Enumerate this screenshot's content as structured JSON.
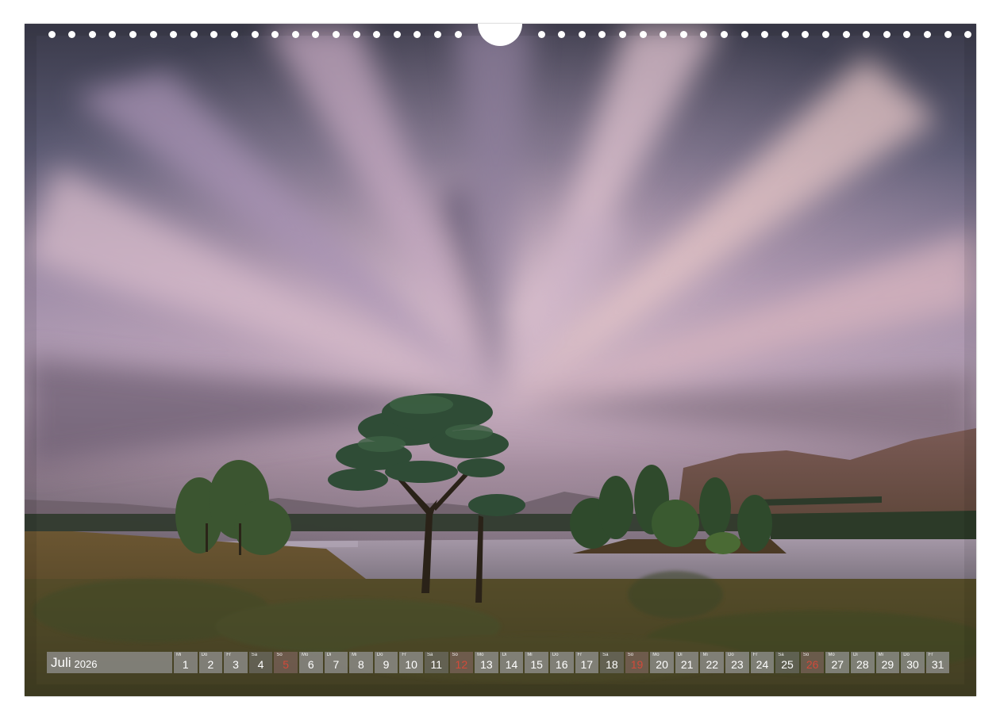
{
  "calendar": {
    "month": "Juli",
    "year": "2026",
    "days": [
      {
        "abbr": "Mi",
        "num": "1",
        "type": "weekday"
      },
      {
        "abbr": "Do",
        "num": "2",
        "type": "weekday"
      },
      {
        "abbr": "Fr",
        "num": "3",
        "type": "weekday"
      },
      {
        "abbr": "Sa",
        "num": "4",
        "type": "weekend"
      },
      {
        "abbr": "So",
        "num": "5",
        "type": "sunday"
      },
      {
        "abbr": "Mo",
        "num": "6",
        "type": "weekday"
      },
      {
        "abbr": "Di",
        "num": "7",
        "type": "weekday"
      },
      {
        "abbr": "Mi",
        "num": "8",
        "type": "weekday"
      },
      {
        "abbr": "Do",
        "num": "9",
        "type": "weekday"
      },
      {
        "abbr": "Fr",
        "num": "10",
        "type": "weekday"
      },
      {
        "abbr": "Sa",
        "num": "11",
        "type": "weekend"
      },
      {
        "abbr": "So",
        "num": "12",
        "type": "sunday"
      },
      {
        "abbr": "Mo",
        "num": "13",
        "type": "weekday"
      },
      {
        "abbr": "Di",
        "num": "14",
        "type": "weekday"
      },
      {
        "abbr": "Mi",
        "num": "15",
        "type": "weekday"
      },
      {
        "abbr": "Do",
        "num": "16",
        "type": "weekday"
      },
      {
        "abbr": "Fr",
        "num": "17",
        "type": "weekday"
      },
      {
        "abbr": "Sa",
        "num": "18",
        "type": "weekend"
      },
      {
        "abbr": "So",
        "num": "19",
        "type": "sunday"
      },
      {
        "abbr": "Mo",
        "num": "20",
        "type": "weekday"
      },
      {
        "abbr": "Di",
        "num": "21",
        "type": "weekday"
      },
      {
        "abbr": "Mi",
        "num": "22",
        "type": "weekday"
      },
      {
        "abbr": "Do",
        "num": "23",
        "type": "weekday"
      },
      {
        "abbr": "Fr",
        "num": "24",
        "type": "weekday"
      },
      {
        "abbr": "Sa",
        "num": "25",
        "type": "weekend"
      },
      {
        "abbr": "So",
        "num": "26",
        "type": "sunday"
      },
      {
        "abbr": "Mo",
        "num": "27",
        "type": "weekday"
      },
      {
        "abbr": "Di",
        "num": "28",
        "type": "weekday"
      },
      {
        "abbr": "Mi",
        "num": "29",
        "type": "weekday"
      },
      {
        "abbr": "Do",
        "num": "30",
        "type": "weekday"
      },
      {
        "abbr": "Fr",
        "num": "31",
        "type": "weekday"
      }
    ]
  },
  "colors": {
    "sunday_number": "#d24a3a",
    "strip_cell": "#969696"
  }
}
